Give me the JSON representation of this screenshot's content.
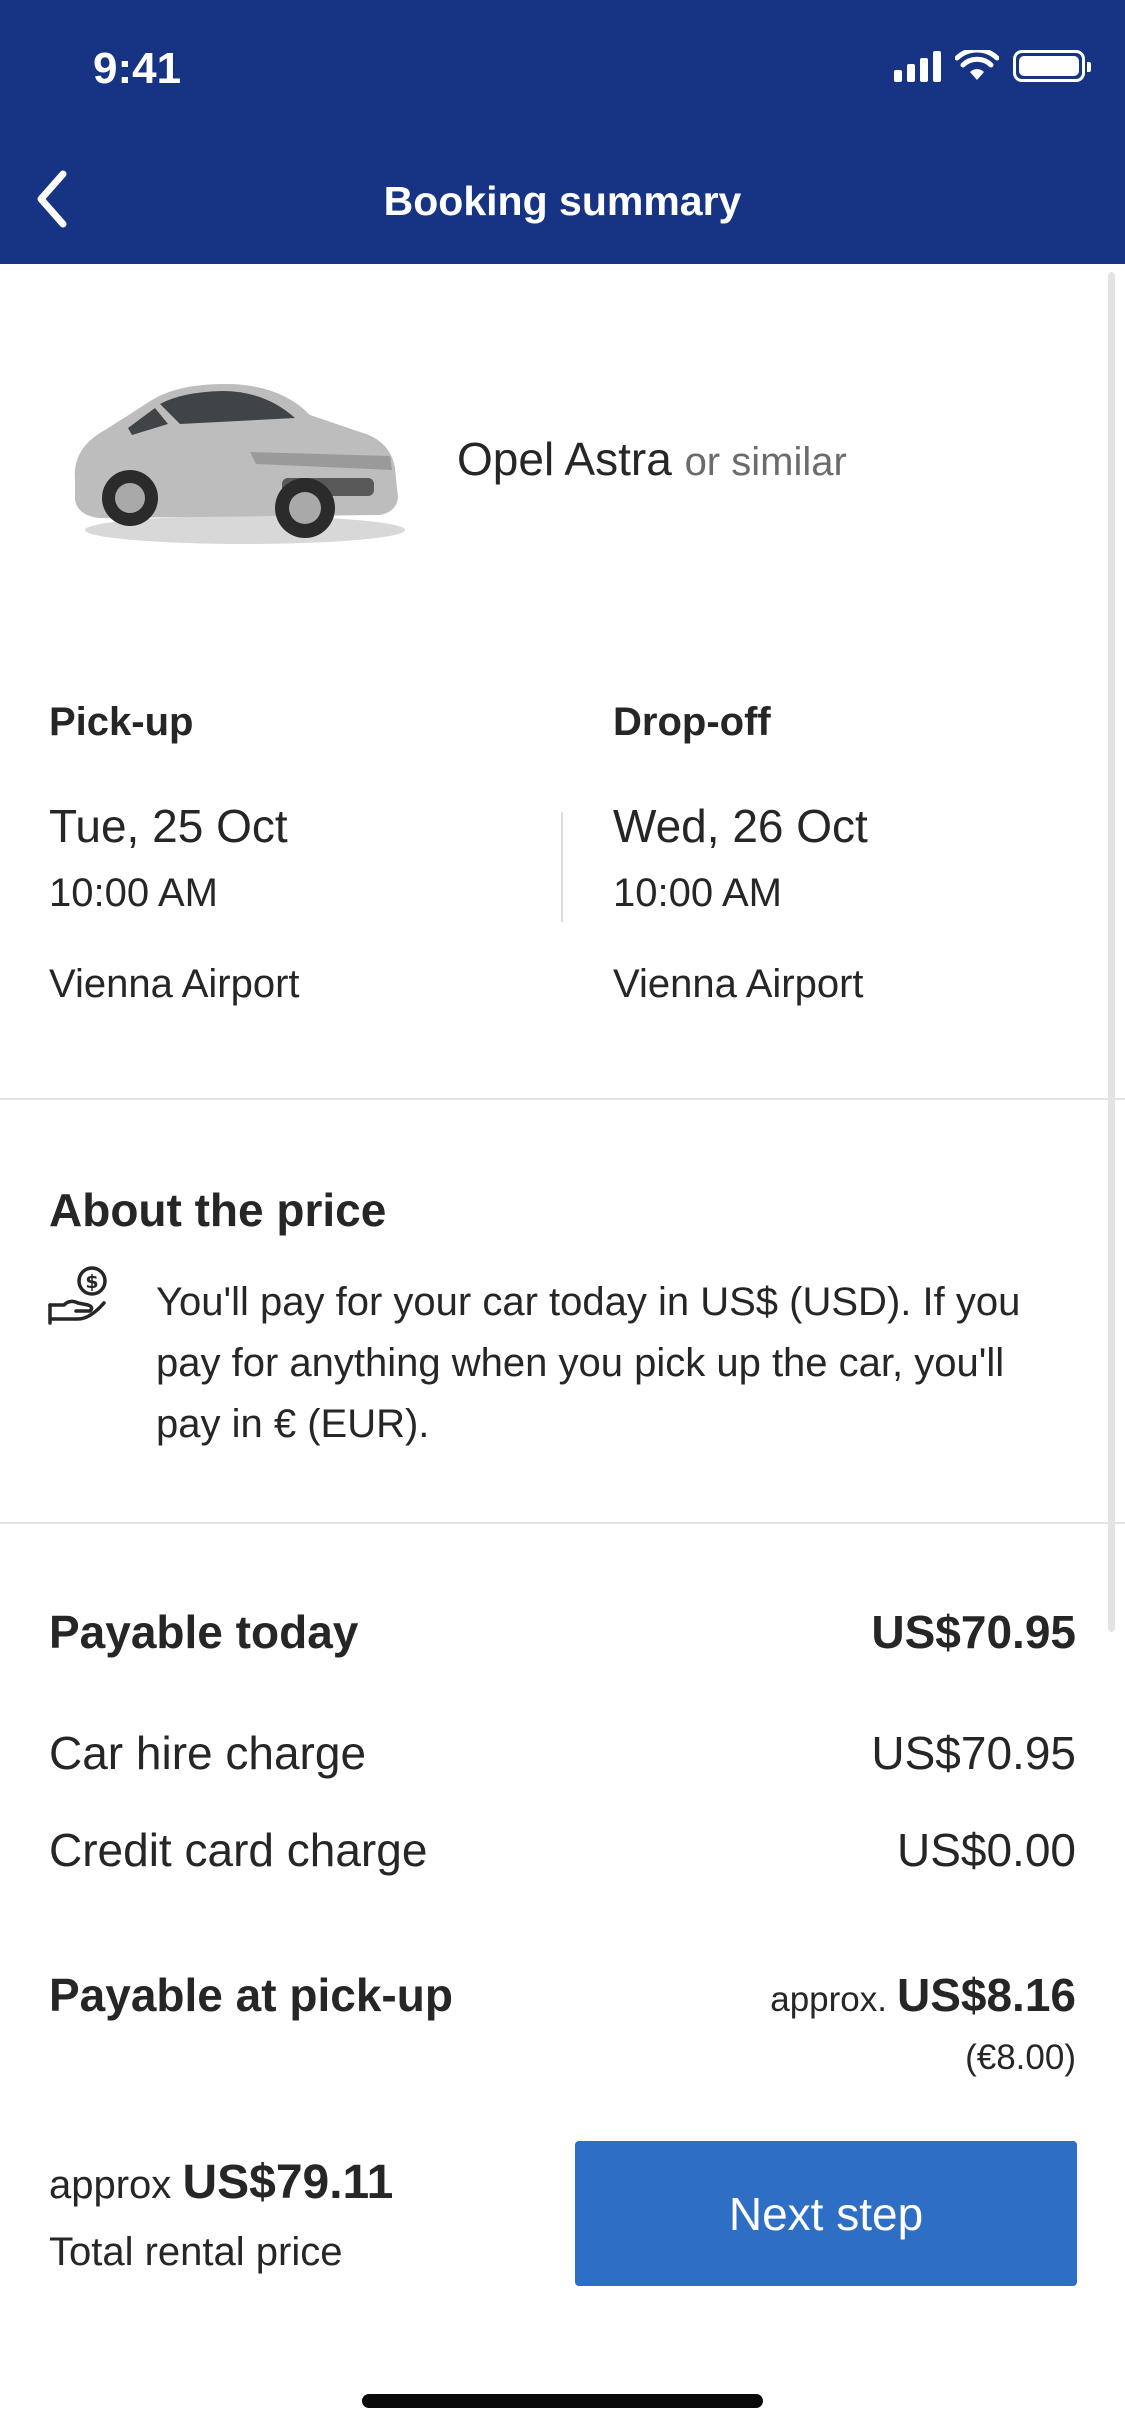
{
  "status_bar": {
    "time": "9:41"
  },
  "header": {
    "title": "Booking summary"
  },
  "car": {
    "name": "Opel Astra",
    "similar": "or similar"
  },
  "pickup": {
    "title": "Pick-up",
    "date": "Tue, 25 Oct",
    "time": "10:00 AM",
    "location": "Vienna Airport"
  },
  "dropoff": {
    "title": "Drop-off",
    "date": "Wed, 26 Oct",
    "time": "10:00 AM",
    "location": "Vienna Airport"
  },
  "about_price": {
    "title": "About the price",
    "icon": "hand-money-icon",
    "text": "You'll pay for your car today in US$ (USD). If you pay for anything when you pick up the car, you'll pay in € (EUR)."
  },
  "payable_today": {
    "label": "Payable today",
    "amount": "US$70.95",
    "items": [
      {
        "label": "Car hire charge",
        "value": "US$70.95"
      },
      {
        "label": "Credit card charge",
        "value": "US$0.00"
      }
    ]
  },
  "payable_at_pickup": {
    "label": "Payable at pick-up",
    "approx": "approx.",
    "amount": "US$8.16",
    "local_amount": "(€8.00)"
  },
  "footer": {
    "approx": "approx",
    "total_amount": "US$79.11",
    "total_label": "Total rental price",
    "next_button": "Next step"
  },
  "colors": {
    "header_bg": "#173484",
    "button_bg": "#2e6ec4",
    "text": "#262626"
  }
}
